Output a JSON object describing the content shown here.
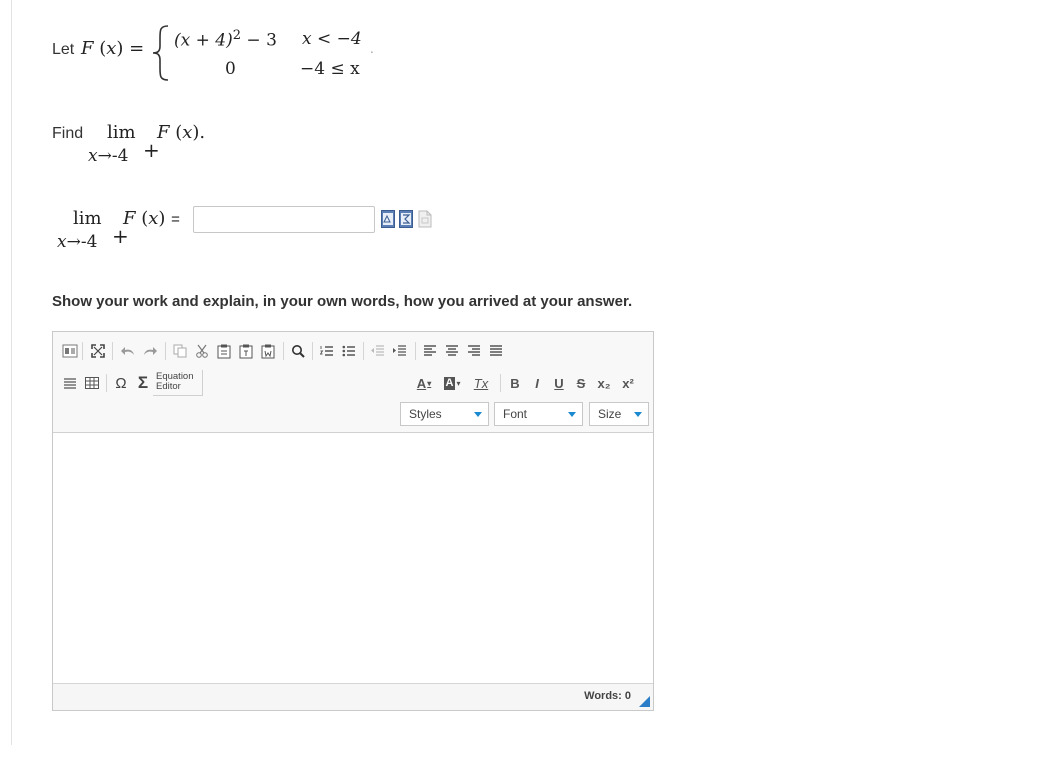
{
  "definition": {
    "intro": "Let",
    "func": "F",
    "var": "x",
    "eq": "=",
    "case1_expr_a": "(x + 4)",
    "case1_exp": "2",
    "case1_expr_b": "− 3",
    "case1_cond": "x < −4",
    "case2_expr": "0",
    "case2_cond": "−4 ≤ x",
    "period": "."
  },
  "question": {
    "find": "Find",
    "lim": "lim",
    "expr": "F (x).",
    "sub": "x→-4",
    "plus": "+"
  },
  "answer": {
    "lim": "lim",
    "expr": "F (x) =",
    "sub": "x→-4",
    "plus": "+",
    "value": ""
  },
  "prompt": "Show your work and explain, in your own words, how you arrived at your answer.",
  "editor": {
    "equation_editor_label_1": "Equation",
    "equation_editor_label_2": "Editor",
    "styles_label": "Styles",
    "font_label": "Font",
    "size_label": "Size",
    "bold": "B",
    "italic": "I",
    "underline": "U",
    "strike": "S",
    "subscript": "x₂",
    "superscript": "x²",
    "font_color": "A",
    "bg_color": "A",
    "remove_format": "Tx",
    "omega": "Ω",
    "sigma": "Σ",
    "words_label": "Words: 0"
  },
  "colors": {
    "accent": "#1a8ad0",
    "border": "#c9c9c9"
  }
}
